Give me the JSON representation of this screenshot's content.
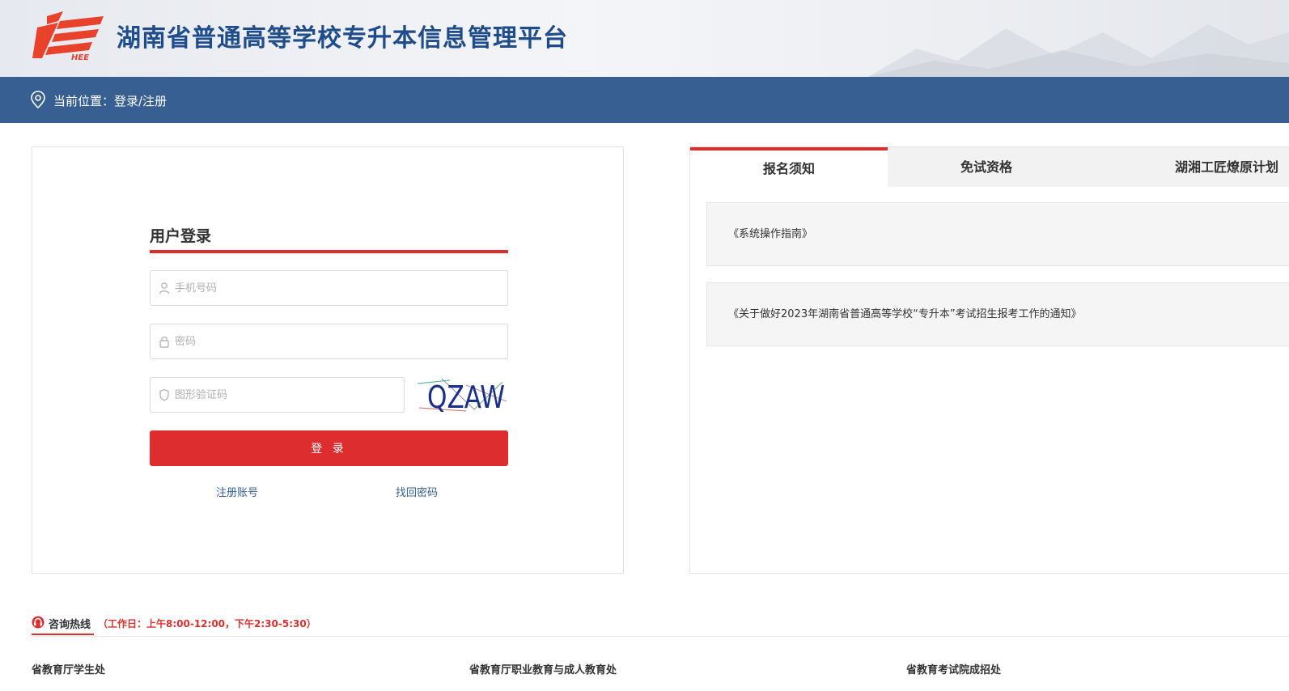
{
  "header": {
    "logo_text": "HEE",
    "site_title": "湖南省普通高等学校专升本信息管理平台"
  },
  "breadcrumb": {
    "text": "当前位置：登录/注册"
  },
  "login": {
    "title": "用户登录",
    "phone_placeholder": "手机号码",
    "password_placeholder": "密码",
    "captcha_placeholder": "图形验证码",
    "captcha_text": "QZAW",
    "submit_label": "登 录",
    "register_link": "注册账号",
    "recover_link": "找回密码"
  },
  "notices": {
    "tabs": [
      {
        "label": "报名须知",
        "active": true
      },
      {
        "label": "免试资格",
        "active": false
      },
      {
        "label": "湖湘工匠燎原计划",
        "active": false
      }
    ],
    "items": [
      {
        "text": "《系统操作指南》"
      },
      {
        "text": "《关于做好2023年湖南省普通高等学校“专升本”考试招生报考工作的通知》"
      }
    ]
  },
  "footer": {
    "hotline_label": "咨询热线",
    "hotline_hours": "（工作日：上午8:00-12:00，下午2:30-5:30）",
    "departments": [
      {
        "name": "省教育厅学生处"
      },
      {
        "name": "省教育厅职业教育与成人教育处"
      },
      {
        "name": "省教育考试院成招处"
      }
    ]
  },
  "colors": {
    "brand_blue": "#375f91",
    "title_blue": "#1f4c8a",
    "accent_red": "#dd2d2f"
  },
  "icons": [
    "location-pin-icon",
    "user-icon",
    "lock-icon",
    "shield-icon",
    "hotline-icon"
  ]
}
